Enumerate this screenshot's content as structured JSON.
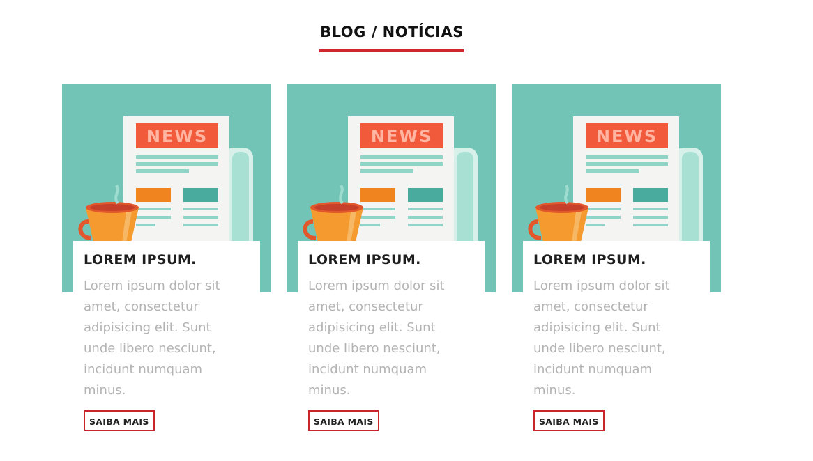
{
  "section": {
    "title": "BLOG / NOTÍCIAS"
  },
  "colors": {
    "accent": "#d0262d",
    "card_image_bg": "#72c4b7",
    "news_banner": "#f15a3a",
    "cup": "#f49a2e"
  },
  "icons": {
    "image": "newspaper-coffee-illustration"
  },
  "image": {
    "banner_text": "NEWS"
  },
  "cards": [
    {
      "title": "LOREM IPSUM.",
      "lines": [
        "Lorem ipsum dolor sit",
        "amet, consectetur",
        "adipisicing elit. Sunt",
        "unde libero nesciunt,",
        "incidunt numquam",
        "minus."
      ],
      "button": "SAIBA MAIS"
    },
    {
      "title": "LOREM IPSUM.",
      "lines": [
        "Lorem ipsum dolor sit",
        "amet, consectetur",
        "adipisicing elit. Sunt",
        "unde libero nesciunt,",
        "incidunt numquam",
        "minus."
      ],
      "button": "SAIBA MAIS"
    },
    {
      "title": "LOREM IPSUM.",
      "lines": [
        "Lorem ipsum dolor sit",
        "amet, consectetur",
        "adipisicing elit. Sunt",
        "unde libero nesciunt,",
        "incidunt numquam",
        "minus."
      ],
      "button": "SAIBA MAIS"
    }
  ]
}
